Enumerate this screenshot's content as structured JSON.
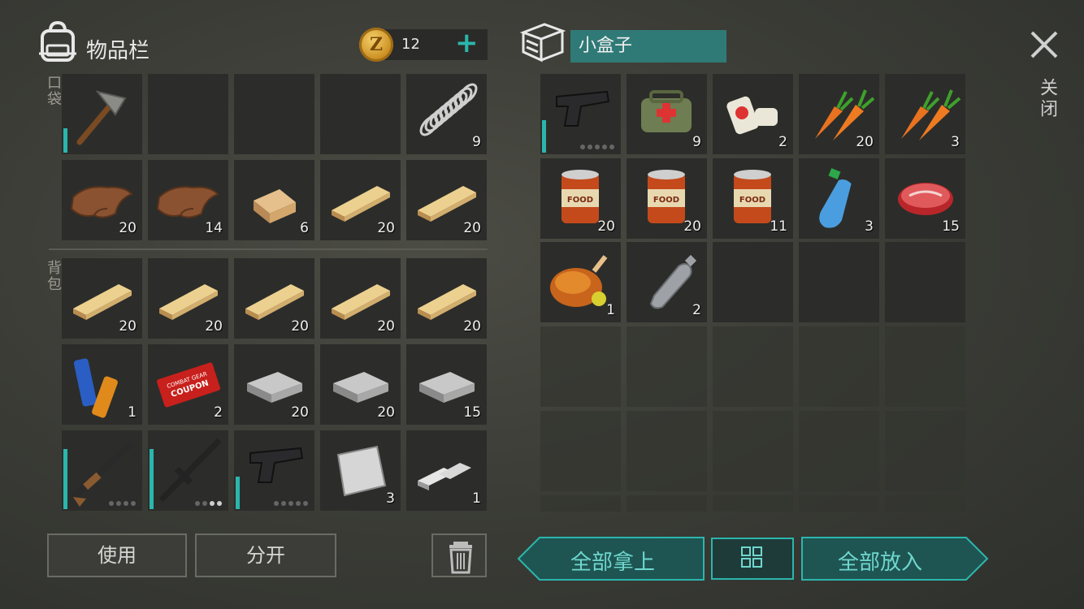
{
  "inventory": {
    "title": "物品栏",
    "coin_symbol": "Z",
    "coins": "12",
    "add_label": "+",
    "pocket_label": "口袋",
    "backpack_label": "背包",
    "pocket_items": [
      {
        "icon": "pickaxe-icon",
        "count": ""
      },
      {
        "icon": "",
        "count": ""
      },
      {
        "icon": "",
        "count": ""
      },
      {
        "icon": "",
        "count": ""
      },
      {
        "icon": "spring-icon",
        "count": "9"
      },
      {
        "icon": "leather-icon",
        "count": "20"
      },
      {
        "icon": "leather-icon",
        "count": "14"
      },
      {
        "icon": "wood-log-icon",
        "count": "6"
      },
      {
        "icon": "wood-plank-icon",
        "count": "20"
      },
      {
        "icon": "wood-plank-icon",
        "count": "20"
      }
    ],
    "backpack_items": [
      {
        "icon": "wood-plank-icon",
        "count": "20"
      },
      {
        "icon": "wood-plank-icon",
        "count": "20"
      },
      {
        "icon": "wood-plank-icon",
        "count": "20"
      },
      {
        "icon": "wood-plank-icon",
        "count": "20"
      },
      {
        "icon": "wood-plank-icon",
        "count": "20"
      },
      {
        "icon": "batteries-icon",
        "count": "1"
      },
      {
        "icon": "coupon-icon",
        "count": "2",
        "text_line1": "COMBAT GEAR",
        "text_line2": "COUPON"
      },
      {
        "icon": "iron-ingot-icon",
        "count": "20"
      },
      {
        "icon": "iron-ingot-icon",
        "count": "20"
      },
      {
        "icon": "iron-ingot-icon",
        "count": "15"
      },
      {
        "icon": "shotgun-icon",
        "count": "",
        "ammo_loaded": 0,
        "ammo_total": 4
      },
      {
        "icon": "rifle-icon",
        "count": "",
        "ammo_loaded": 2,
        "ammo_total": 4
      },
      {
        "icon": "pistol-icon",
        "count": "",
        "ammo_loaded": 0,
        "ammo_total": 5
      },
      {
        "icon": "steel-sheet-icon",
        "count": "3"
      },
      {
        "icon": "silver-bars-icon",
        "count": "1"
      }
    ],
    "use_label": "使用",
    "split_label": "分开"
  },
  "box": {
    "name": "小盒子",
    "items": [
      {
        "icon": "pistol-icon",
        "count": "",
        "ammo_loaded": 0,
        "ammo_total": 5
      },
      {
        "icon": "medkit-bag-icon",
        "count": "9"
      },
      {
        "icon": "bandage-icon",
        "count": "2"
      },
      {
        "icon": "carrot-icon",
        "count": "20"
      },
      {
        "icon": "carrot-icon",
        "count": "3"
      },
      {
        "icon": "canned-food-icon",
        "count": "20",
        "label": "FOOD"
      },
      {
        "icon": "canned-food-icon",
        "count": "20",
        "label": "FOOD"
      },
      {
        "icon": "canned-food-icon",
        "count": "11",
        "label": "FOOD"
      },
      {
        "icon": "water-bottle-icon",
        "count": "3"
      },
      {
        "icon": "raw-meat-icon",
        "count": "15"
      },
      {
        "icon": "roast-chicken-icon",
        "count": "1"
      },
      {
        "icon": "empty-bottle-icon",
        "count": "2"
      }
    ],
    "take_all_label": "全部拿上",
    "put_all_label": "全部放入"
  },
  "close_label": "关闭",
  "colors": {
    "accent": "#2bb6ad",
    "durability": "#2bb6ad",
    "box_name_bg": "#2f7a76"
  }
}
